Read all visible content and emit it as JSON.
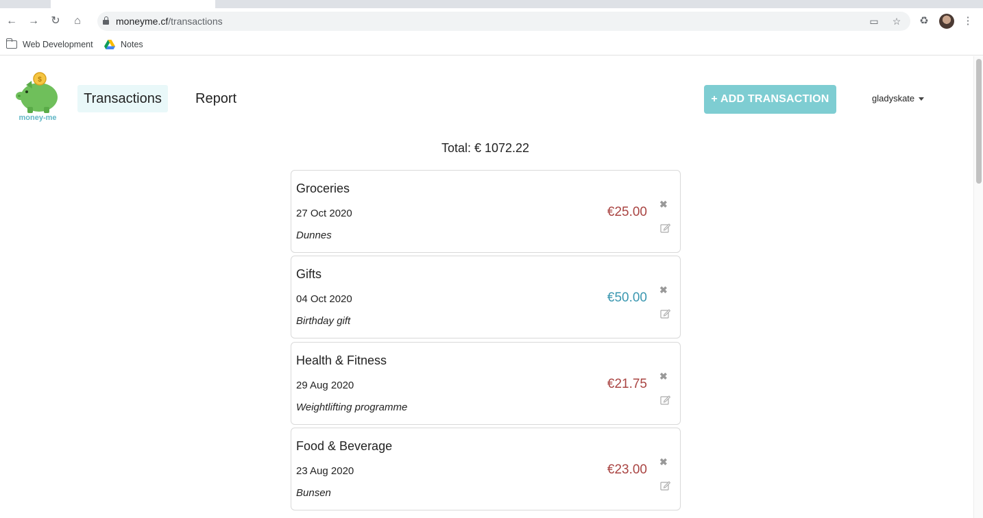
{
  "browser": {
    "url_host": "moneyme.cf",
    "url_path": "/transactions",
    "bookmarks": [
      {
        "label": "Web Development",
        "icon": "folder-icon"
      },
      {
        "label": "Notes",
        "icon": "google-drive-icon"
      }
    ]
  },
  "app": {
    "logo_text": "money-me",
    "nav": {
      "transactions": "Transactions",
      "report": "Report"
    },
    "add_button": "+ ADD TRANSACTION",
    "user": "gladyskate",
    "total": "Total: € 1072.22"
  },
  "colors": {
    "accent": "#7ecdd2",
    "expense": "#a94442",
    "income": "#3a97b0",
    "nav_active_bg": "#e9f8f9"
  },
  "transactions": [
    {
      "category": "Groceries",
      "date": "27 Oct 2020",
      "note": "Dunnes",
      "amount": "€25.00",
      "type": "expense"
    },
    {
      "category": "Gifts",
      "date": "04 Oct 2020",
      "note": "Birthday gift",
      "amount": "€50.00",
      "type": "income"
    },
    {
      "category": "Health & Fitness",
      "date": "29 Aug 2020",
      "note": "Weightlifting programme",
      "amount": "€21.75",
      "type": "expense"
    },
    {
      "category": "Food & Beverage",
      "date": "23 Aug 2020",
      "note": "Bunsen",
      "amount": "€23.00",
      "type": "expense"
    }
  ]
}
